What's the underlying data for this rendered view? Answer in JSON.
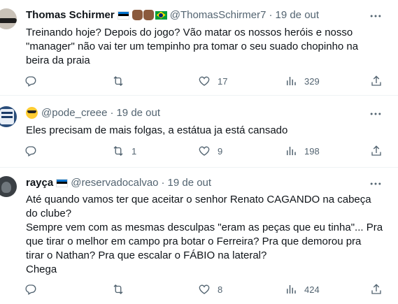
{
  "tweets": [
    {
      "name": "Thomas Schirmer",
      "handle": "@ThomasSchirmer7",
      "sep": "·",
      "time": "19 de out",
      "text": "Treinando hoje? Depois do jogo? Vão matar os nossos heróis e nosso\n\"manager\" não vai ter um tempinho pra tomar o seu suado chopinho na\nbeira da praia",
      "reply_count": "",
      "retweet_count": "",
      "like_count": "17",
      "view_count": "329",
      "badges": [
        "flag-estonia",
        "fist-emoji",
        "fist-emoji",
        "flag-brazil"
      ]
    },
    {
      "name": "",
      "handle": "@pode_creee",
      "sep": "·",
      "time": "19 de out",
      "text": "Eles precisam de mais folgas, a estátua ja está cansado",
      "reply_count": "",
      "retweet_count": "1",
      "like_count": "9",
      "view_count": "198",
      "badges": [
        "smiling-face-with-sunglasses-emoji"
      ]
    },
    {
      "name": "rayça",
      "handle": "@reservadocalvao",
      "sep": "·",
      "time": "19 de out",
      "text": "Até quando vamos ter que aceitar o senhor Renato CAGANDO na cabeça\ndo clube?\nSempre vem com as mesmas desculpas \"eram as peças que eu tinha\"... Pra\nque tirar o melhor em campo pra botar o Ferreira? Pra que demorou pra\ntirar o Nathan? Pra que escalar o FÁBIO na lateral?\nChega",
      "reply_count": "",
      "retweet_count": "",
      "like_count": "8",
      "view_count": "424",
      "badges": [
        "flag-estonia"
      ]
    }
  ],
  "icons": {
    "reply": "reply-icon",
    "retweet": "retweet-icon",
    "like": "heart-icon",
    "views": "views-icon",
    "share": "share-icon",
    "more": "more-icon"
  },
  "colors": {
    "text": "#0f1419",
    "secondary": "#536471",
    "divider": "#eff3f4"
  }
}
